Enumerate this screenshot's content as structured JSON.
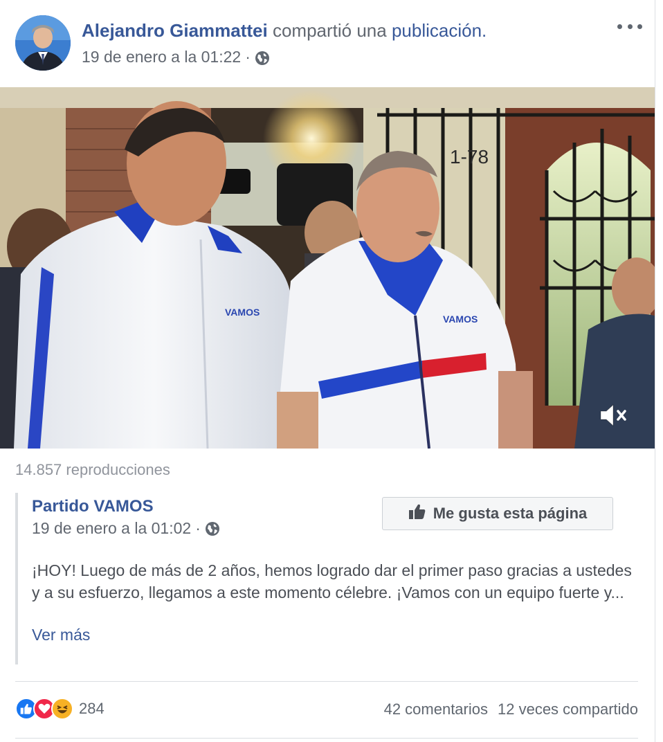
{
  "post": {
    "author": "Alejandro Giammattei",
    "verb": "compartió una",
    "object": "publicación.",
    "timestamp": "19 de enero a la 01:22",
    "separator": "·",
    "privacy_icon": "globe-icon",
    "menu_icon": "more-options-icon"
  },
  "video": {
    "mute_icon": "muted-speaker-icon",
    "views": "14.857 reproducciones"
  },
  "shared_post": {
    "page_name": "Partido VAMOS",
    "timestamp": "19 de enero a la 01:02",
    "separator": "·",
    "like_button_label": "Me gusta esta página",
    "text": "¡HOY! Luego de más de 2 años, hemos logrado dar el primer paso gracias a ustedes y a su esfuerzo, llegamos a este momento célebre. ¡Vamos con un equipo fuerte y...",
    "see_more": "Ver más"
  },
  "footer": {
    "reaction_icons": [
      "like-icon",
      "love-icon",
      "haha-icon"
    ],
    "reaction_count": "284",
    "comments": "42 comentarios",
    "shares": "12 veces compartido"
  },
  "colors": {
    "link": "#385898",
    "secondary_text": "#616770",
    "like_blue": "#1877f2",
    "love_red": "#f0284a",
    "haha_yellow": "#f7b125"
  }
}
